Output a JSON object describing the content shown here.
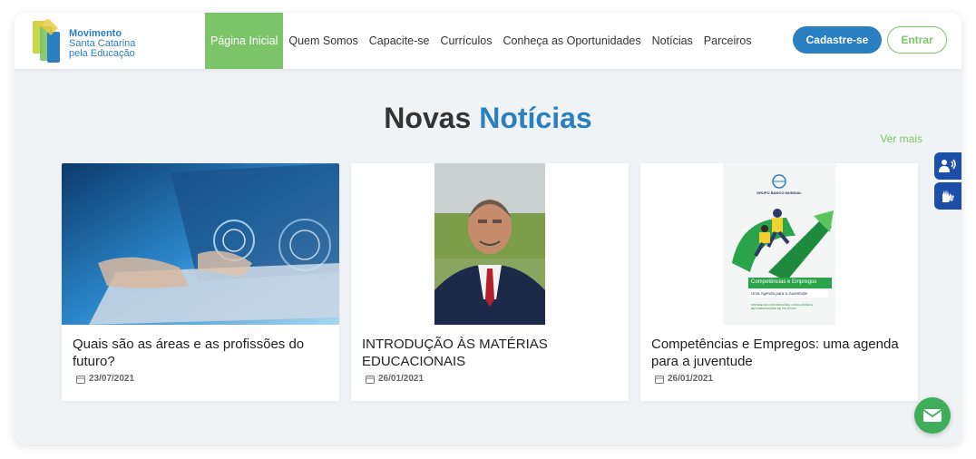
{
  "logo": {
    "line1": "Movimento",
    "line2": "Santa Catarina",
    "line3": "pela Educação"
  },
  "nav": {
    "items": [
      {
        "label": "Página Inicial",
        "active": true
      },
      {
        "label": "Quem Somos"
      },
      {
        "label": "Capacite-se"
      },
      {
        "label": "Currículos"
      },
      {
        "label": "Conheça as Oportunidades"
      },
      {
        "label": "Notícias"
      },
      {
        "label": "Parceiros"
      }
    ],
    "cadastre_label": "Cadastre-se",
    "entrar_label": "Entrar"
  },
  "section": {
    "title_plain": "Novas ",
    "title_accent": "Notícias",
    "ver_mais": "Ver mais"
  },
  "cards": [
    {
      "title": "Quais são as áreas e as profissões do futuro?",
      "date": "23/07/2021",
      "image": "laptop-technology-photo"
    },
    {
      "title": "INTRODUÇÃO ÀS MATÉRIAS EDUCACIONAIS",
      "date": "26/01/2021",
      "image": "man-in-suit-portrait"
    },
    {
      "title": "Competências e Empregos: uma agenda para a juventude",
      "date": "26/01/2021",
      "image": "report-cover"
    }
  ],
  "report_cover": {
    "org": "GRUPO BANCO MUNDIAL",
    "title": "Competências e Empregos",
    "subtitle": "Uma Agenda para a Juventude",
    "footer": "SÍNTESE DE CONSTATAÇÕES, CONCLUSÕES E RECOMENDAÇÕES DE POLÍTICAS"
  },
  "colors": {
    "brand_blue": "#2a7fc1",
    "brand_green": "#7cc46a",
    "access_blue": "#1e4fa8",
    "chat_green": "#3fae5a"
  },
  "icons": [
    "calendar-icon",
    "audio-accessibility-icon",
    "sign-language-icon",
    "envelope-icon"
  ]
}
